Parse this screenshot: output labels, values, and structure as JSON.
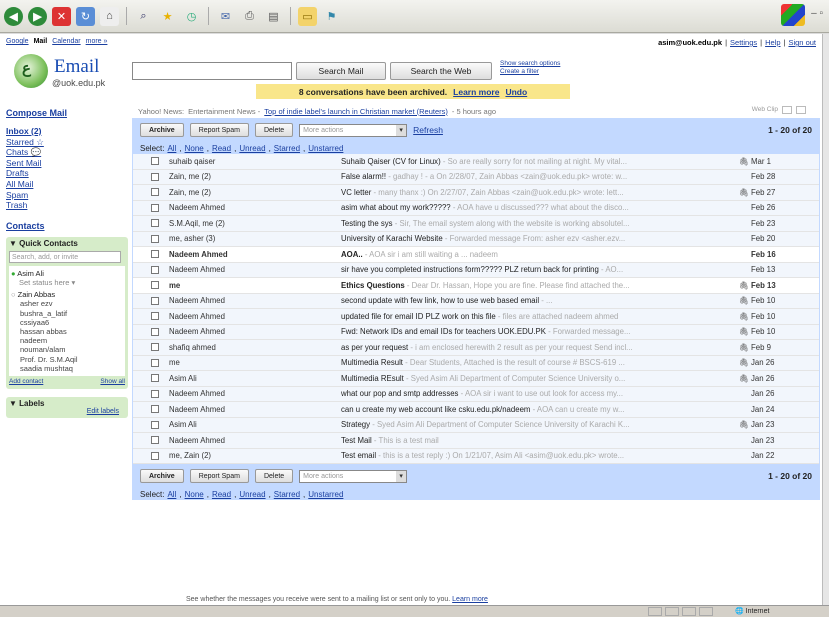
{
  "ie": {
    "icons": [
      "back-icon",
      "forward-icon",
      "stop-icon",
      "refresh-icon",
      "home-icon",
      "search-icon",
      "favorites-icon",
      "history-icon",
      "mail-icon",
      "print-icon",
      "edit-icon",
      "folder-icon",
      "messenger-icon"
    ]
  },
  "topnav": {
    "items": [
      "Google",
      "Mail",
      "Calendar",
      "more »"
    ]
  },
  "account": {
    "email": "asim@uok.edu.pk",
    "settings": "Settings",
    "help": "Help",
    "signout": "Sign out"
  },
  "logo": {
    "title": "Email",
    "domain": "@uok.edu.pk",
    "glyph": "ع"
  },
  "search": {
    "value": "",
    "mail_button": "Search Mail",
    "web_button": "Search the Web",
    "options": "Show search options",
    "filter": "Create a filter"
  },
  "notice": {
    "text": "8 conversations have been archived.",
    "learn": "Learn more",
    "undo": "Undo"
  },
  "sidebar": {
    "compose": "Compose Mail",
    "nav": [
      "Inbox (2)",
      "Starred ☆",
      "Chats 💬",
      "Sent Mail",
      "Drafts",
      "All Mail",
      "Spam",
      "Trash"
    ],
    "contacts": "Contacts",
    "quick_contacts": "Quick Contacts",
    "qc_search": "Search, add, or invite",
    "me": "Asim Ali",
    "status": "Set status here ▾",
    "list": [
      "Zain Abbas",
      "asher ezv",
      "bushra_a_latif",
      "cssiyaa6",
      "hassan abbas",
      "nadeem",
      "nouman/alam",
      "Prof. Dr. S.M.Aqil",
      "saadia mushtaq"
    ],
    "add_contact": "Add contact",
    "show_all": "Show all",
    "labels": "Labels",
    "edit_labels": "Edit labels"
  },
  "news": {
    "source": "Yahoo! News:",
    "category": "Entertainment News -",
    "headline": "Top of indie label's launch in Christian market (Reuters)",
    "age": "- 5 hours ago",
    "nav": "Web Clip"
  },
  "actions": {
    "archive": "Archive",
    "spam": "Report Spam",
    "delete": "Delete",
    "more": "More actions",
    "refresh": "Refresh",
    "count": "1 - 20 of 20",
    "select_prefix": "Select:",
    "select": [
      "All",
      "None",
      "Read",
      "Unread",
      "Starred",
      "Unstarred"
    ]
  },
  "emails": [
    {
      "from": "suhaib qaiser",
      "subject": "Suhaib Qaiser (CV for Linux)",
      "snippet": " - So are really sorry for not mailing at night. My vital...",
      "clip": "🖇",
      "date": "Mar 1",
      "unread": false
    },
    {
      "from": "Zain, me (2)",
      "subject": "False alarm!!",
      "snippet": " - gadhay ! - a On 2/28/07, Zain Abbas <zain@uok.edu.pk> wrote: w...",
      "clip": "",
      "date": "Feb 28",
      "unread": false
    },
    {
      "from": "Zain, me (2)",
      "subject": "VC letter",
      "snippet": " - many thanx :) On 2/27/07, Zain Abbas <zain@uok.edu.pk> wrote: lett...",
      "clip": "🖇",
      "date": "Feb 27",
      "unread": false
    },
    {
      "from": "Nadeem Ahmed",
      "subject": "asim what about my work?????",
      "snippet": " - AOA have u discussed??? what about the disco...",
      "clip": "",
      "date": "Feb 26",
      "unread": false
    },
    {
      "from": "S.M.Aqil, me (2)",
      "subject": "Testing the sys",
      "snippet": " - Sir, The email system along with the website is working absolutel...",
      "clip": "",
      "date": "Feb 23",
      "unread": false
    },
    {
      "from": "me, asher (3)",
      "subject": "University of Karachi Website",
      "snippet": " - Forwarded message From: asher ezv <asher.ezv...",
      "clip": "",
      "date": "Feb 20",
      "unread": false
    },
    {
      "from": "Nadeem Ahmed",
      "subject": "AOA..",
      "snippet": " - AOA sir i am still waiting a ... nadeem",
      "clip": "",
      "date": "Feb 16",
      "unread": true
    },
    {
      "from": "Nadeem Ahmed",
      "subject": "sir have you completed instructions form????? PLZ return back for printing",
      "snippet": " - AO...",
      "clip": "",
      "date": "Feb 13",
      "unread": false
    },
    {
      "from": "me",
      "subject": "Ethics Questions",
      "snippet": " - Dear Dr. Hassan, Hope you are fine. Please find attached the...",
      "clip": "🖇",
      "date": "Feb 13",
      "unread": true
    },
    {
      "from": "Nadeem Ahmed",
      "subject": "second update with few link, how to use web based email",
      "snippet": " - ...",
      "clip": "🖇",
      "date": "Feb 10",
      "unread": false
    },
    {
      "from": "Nadeem Ahmed",
      "subject": "updated file for email ID PLZ work on this file",
      "snippet": " - files are attached nadeem ahmed",
      "clip": "🖇",
      "date": "Feb 10",
      "unread": false
    },
    {
      "from": "Nadeem Ahmed",
      "subject": "Fwd: Network IDs and email IDs for teachers UOK.EDU.PK",
      "snippet": " - Forwarded message...",
      "clip": "🖇",
      "date": "Feb 10",
      "unread": false
    },
    {
      "from": "shafiq ahmed",
      "subject": "as per your request",
      "snippet": " - i am enclosed herewith 2 result as per your request Send incl...",
      "clip": "🖇",
      "date": "Feb 9",
      "unread": false
    },
    {
      "from": "me",
      "subject": "Multimedia Result",
      "snippet": " - Dear Students, Attached is the result of course # BSCS-619 ...",
      "clip": "🖇",
      "date": "Jan 26",
      "unread": false
    },
    {
      "from": "Asim Ali",
      "subject": "Multimedia REsult",
      "snippet": " - Syed Asim Ali Department of Computer Science University o...",
      "clip": "🖇",
      "date": "Jan 26",
      "unread": false
    },
    {
      "from": "Nadeem Ahmed",
      "subject": "what our pop and smtp addresses",
      "snippet": " - AOA sir i want to use out look for access my...",
      "clip": "",
      "date": "Jan 26",
      "unread": false
    },
    {
      "from": "Nadeem Ahmed",
      "subject": "can u create my web account like csku.edu.pk/nadeem",
      "snippet": " - AOA can u create my w...",
      "clip": "",
      "date": "Jan 24",
      "unread": false
    },
    {
      "from": "Asim Ali",
      "subject": "Strategy",
      "snippet": " - Syed Asim Ali Department of Computer Science University of Karachi K...",
      "clip": "🖇",
      "date": "Jan 23",
      "unread": false
    },
    {
      "from": "Nadeem Ahmed",
      "subject": "Test Mail",
      "snippet": " - This is a test mail",
      "clip": "",
      "date": "Jan 23",
      "unread": false
    },
    {
      "from": "me, Zain (2)",
      "subject": "Test email",
      "snippet": " - this is a test reply :) On 1/21/07, Asim Ali <asim@uok.edu.pk> wrote...",
      "clip": "",
      "date": "Jan 22",
      "unread": false
    }
  ],
  "footer": {
    "text": "See whether the messages you receive were sent to a mailing list or sent only to you.",
    "link": "Learn more"
  },
  "statusbar": {
    "zone": "Internet"
  }
}
